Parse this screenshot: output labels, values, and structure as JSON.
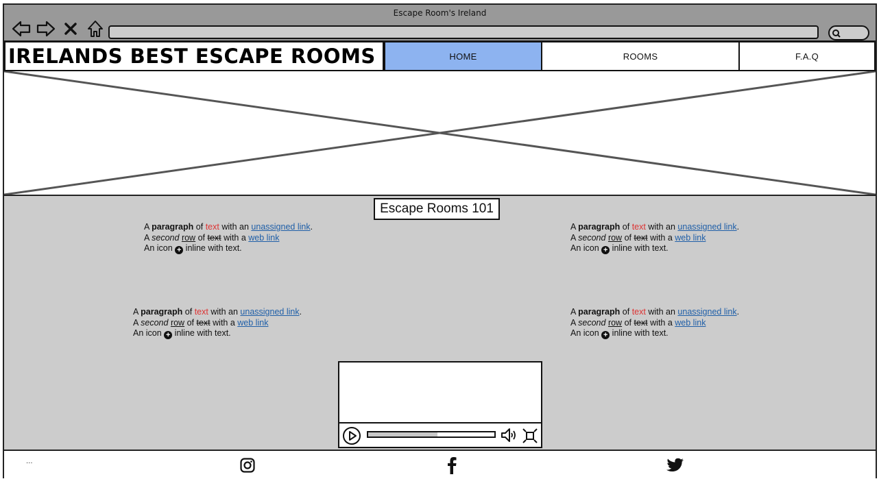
{
  "window": {
    "title": "Escape Room's Ireland"
  },
  "header": {
    "site_title": "IRELANDS BEST ESCAPE ROOMS",
    "nav": [
      {
        "label": "HOME",
        "active": true
      },
      {
        "label": "ROOMS",
        "active": false
      },
      {
        "label": "F.A.Q",
        "active": false
      }
    ]
  },
  "main": {
    "section_title": "Escape Rooms 101",
    "paragraph": {
      "line1": {
        "a": "A",
        "b": "paragraph",
        "c": "of",
        "d": "text",
        "e": "with an",
        "f": "unassigned link",
        "g": "."
      },
      "line2": {
        "a": "A",
        "b": "second",
        "c": "row",
        "d": "of",
        "e": "text",
        "f": "with a",
        "g": "web link"
      },
      "line3": {
        "a": "An icon",
        "b": "inline with text."
      }
    }
  },
  "video": {
    "progress": 0.55
  },
  "footer": {
    "left_text": "...",
    "social": [
      "instagram-icon",
      "facebook-icon",
      "twitter-icon"
    ]
  },
  "colors": {
    "active_tab": "#8db3f0",
    "main_bg": "#cccccc",
    "link": "#1f5fa8",
    "red_text": "#dd3333"
  }
}
